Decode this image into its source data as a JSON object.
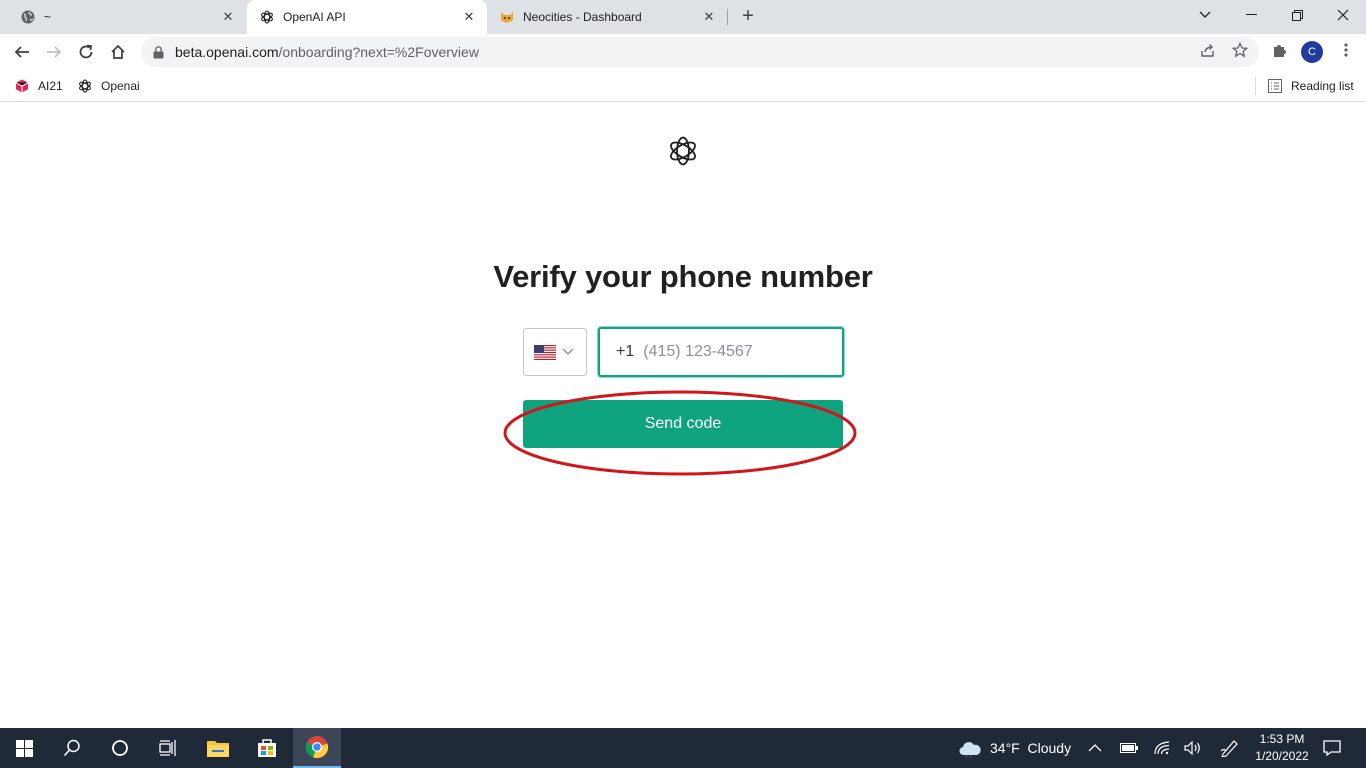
{
  "browser": {
    "tabs": [
      {
        "title": "~",
        "favicon": "globe-icon",
        "active": false
      },
      {
        "title": "OpenAI API",
        "favicon": "openai-icon",
        "active": true
      },
      {
        "title": "Neocities - Dashboard",
        "favicon": "neocities-cat-icon",
        "active": false
      }
    ],
    "url": {
      "host": "beta.openai.com",
      "path": "/onboarding?next=%2Foverview"
    },
    "profile_initial": "C",
    "bookmarks": [
      {
        "label": "AI21",
        "icon": "ai21-icon"
      },
      {
        "label": "Openai",
        "icon": "openai-icon"
      }
    ],
    "reading_list_label": "Reading list"
  },
  "page": {
    "heading": "Verify your phone number",
    "country_flag": "us-flag-icon",
    "dial_prefix": "+1",
    "phone_placeholder": "(415) 123-4567",
    "send_button_label": "Send code",
    "accent_color": "#10a37f",
    "annotation_color": "#d0171b"
  },
  "taskbar": {
    "weather": "34°F  Cloudy",
    "time": "1:53 PM",
    "date": "1/20/2022"
  }
}
